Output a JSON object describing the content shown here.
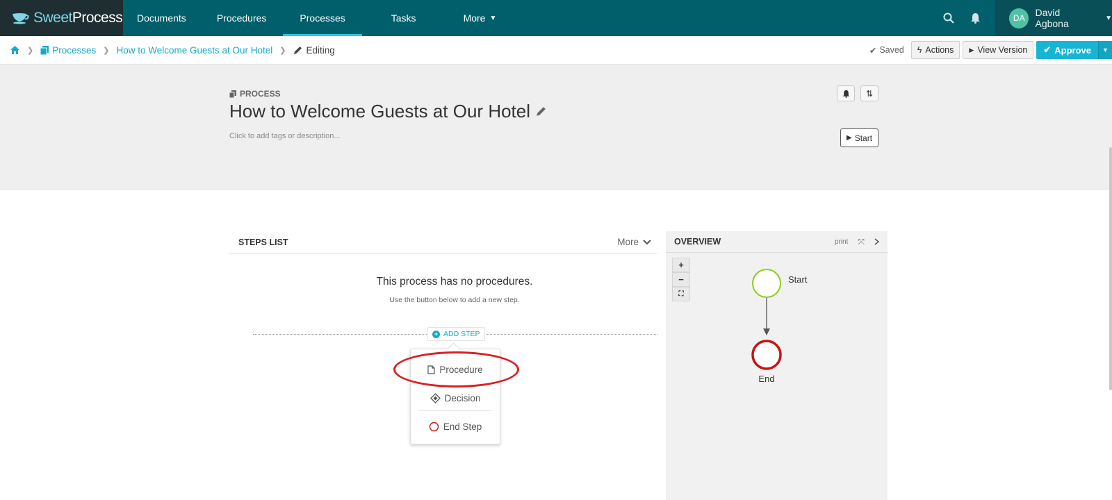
{
  "brand": {
    "name_part1": "Sweet",
    "name_part2": "Process"
  },
  "nav": {
    "items": [
      {
        "label": "Documents",
        "active": false
      },
      {
        "label": "Procedures",
        "active": false
      },
      {
        "label": "Processes",
        "active": true
      },
      {
        "label": "Tasks",
        "active": false
      },
      {
        "label": "More",
        "active": false
      }
    ],
    "user": {
      "initials": "DA",
      "name": "David Agbona"
    }
  },
  "breadcrumb": {
    "processes": "Processes",
    "process_name": "How to Welcome Guests at Our Hotel",
    "current": "Editing"
  },
  "toolbar": {
    "saved": "Saved",
    "actions": "Actions",
    "view_version": "View Version",
    "approve": "Approve"
  },
  "process": {
    "label": "PROCESS",
    "title": "How to Welcome Guests at Our Hotel",
    "description_placeholder": "Click to add tags or description...",
    "start": "Start"
  },
  "steps": {
    "title": "STEPS LIST",
    "more": "More",
    "empty_title": "This process has no procedures.",
    "empty_sub": "Use the button below to add a new step.",
    "add_step": "ADD STEP",
    "menu": {
      "procedure": "Procedure",
      "decision": "Decision",
      "end_step": "End Step"
    }
  },
  "overview": {
    "title": "OVERVIEW",
    "print": "print",
    "zoom_in": "+",
    "zoom_out": "−",
    "nodes": {
      "start": "Start",
      "end": "End"
    }
  },
  "colors": {
    "nav_bg": "#005f6b",
    "accent": "#18a9c7",
    "start_node": "#8ccc1f",
    "end_node": "#c81414",
    "highlight": "#d92020"
  }
}
